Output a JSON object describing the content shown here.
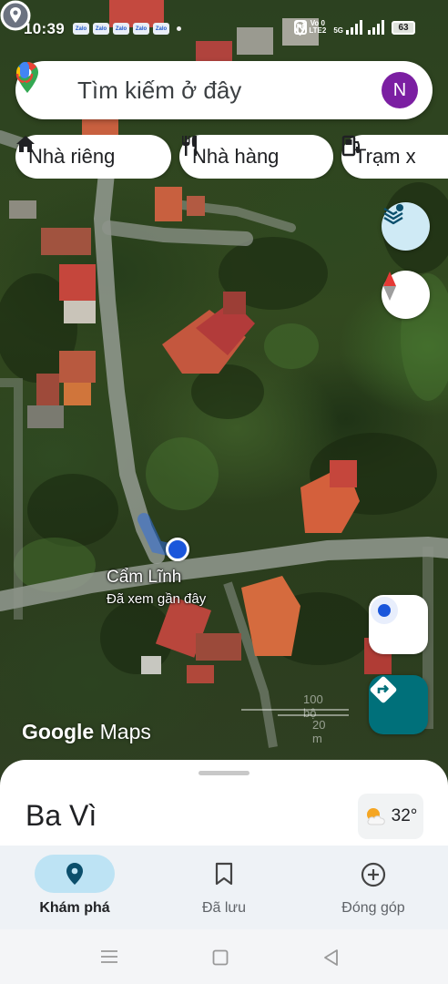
{
  "status_bar": {
    "time": "10:39",
    "notifications": [
      "Zalo",
      "Zalo",
      "Zalo",
      "Zalo",
      "Zalo"
    ],
    "network_label_top": "Vo 0",
    "network_label_bottom": "LTE2",
    "signal_label": "5G",
    "battery": "63",
    "icons": [
      "nfc-icon",
      "location-icon",
      "signal-icon",
      "battery-icon"
    ]
  },
  "search": {
    "placeholder": "Tìm kiếm ở đây",
    "avatar_initial": "N"
  },
  "chips": [
    {
      "label": "Nhà riêng",
      "icon": "home-icon"
    },
    {
      "label": "Nhà hàng",
      "icon": "restaurant-icon"
    },
    {
      "label": "Trạm x",
      "icon": "gas-station-icon"
    }
  ],
  "map": {
    "place": {
      "name": "Cẩm Lĩnh",
      "subtitle": "Đã xem gần đây"
    },
    "logo_google": "Google",
    "logo_maps": "Maps",
    "scale_top": "100 bộ",
    "scale_bottom": "20 m"
  },
  "sheet": {
    "title": "Ba Vì",
    "weather_temp": "32°",
    "weather_icon": "partly-cloudy-icon"
  },
  "bottom_nav": [
    {
      "label": "Khám phá",
      "icon": "explore-pin-icon",
      "active": true
    },
    {
      "label": "Đã lưu",
      "icon": "bookmark-icon",
      "active": false
    },
    {
      "label": "Đóng góp",
      "icon": "add-circle-icon",
      "active": false
    }
  ],
  "colors": {
    "accent_blue": "#1a56db",
    "directions_teal": "#00707a",
    "nav_active_pill": "#bde3f4",
    "avatar_purple": "#7b1fa2"
  }
}
